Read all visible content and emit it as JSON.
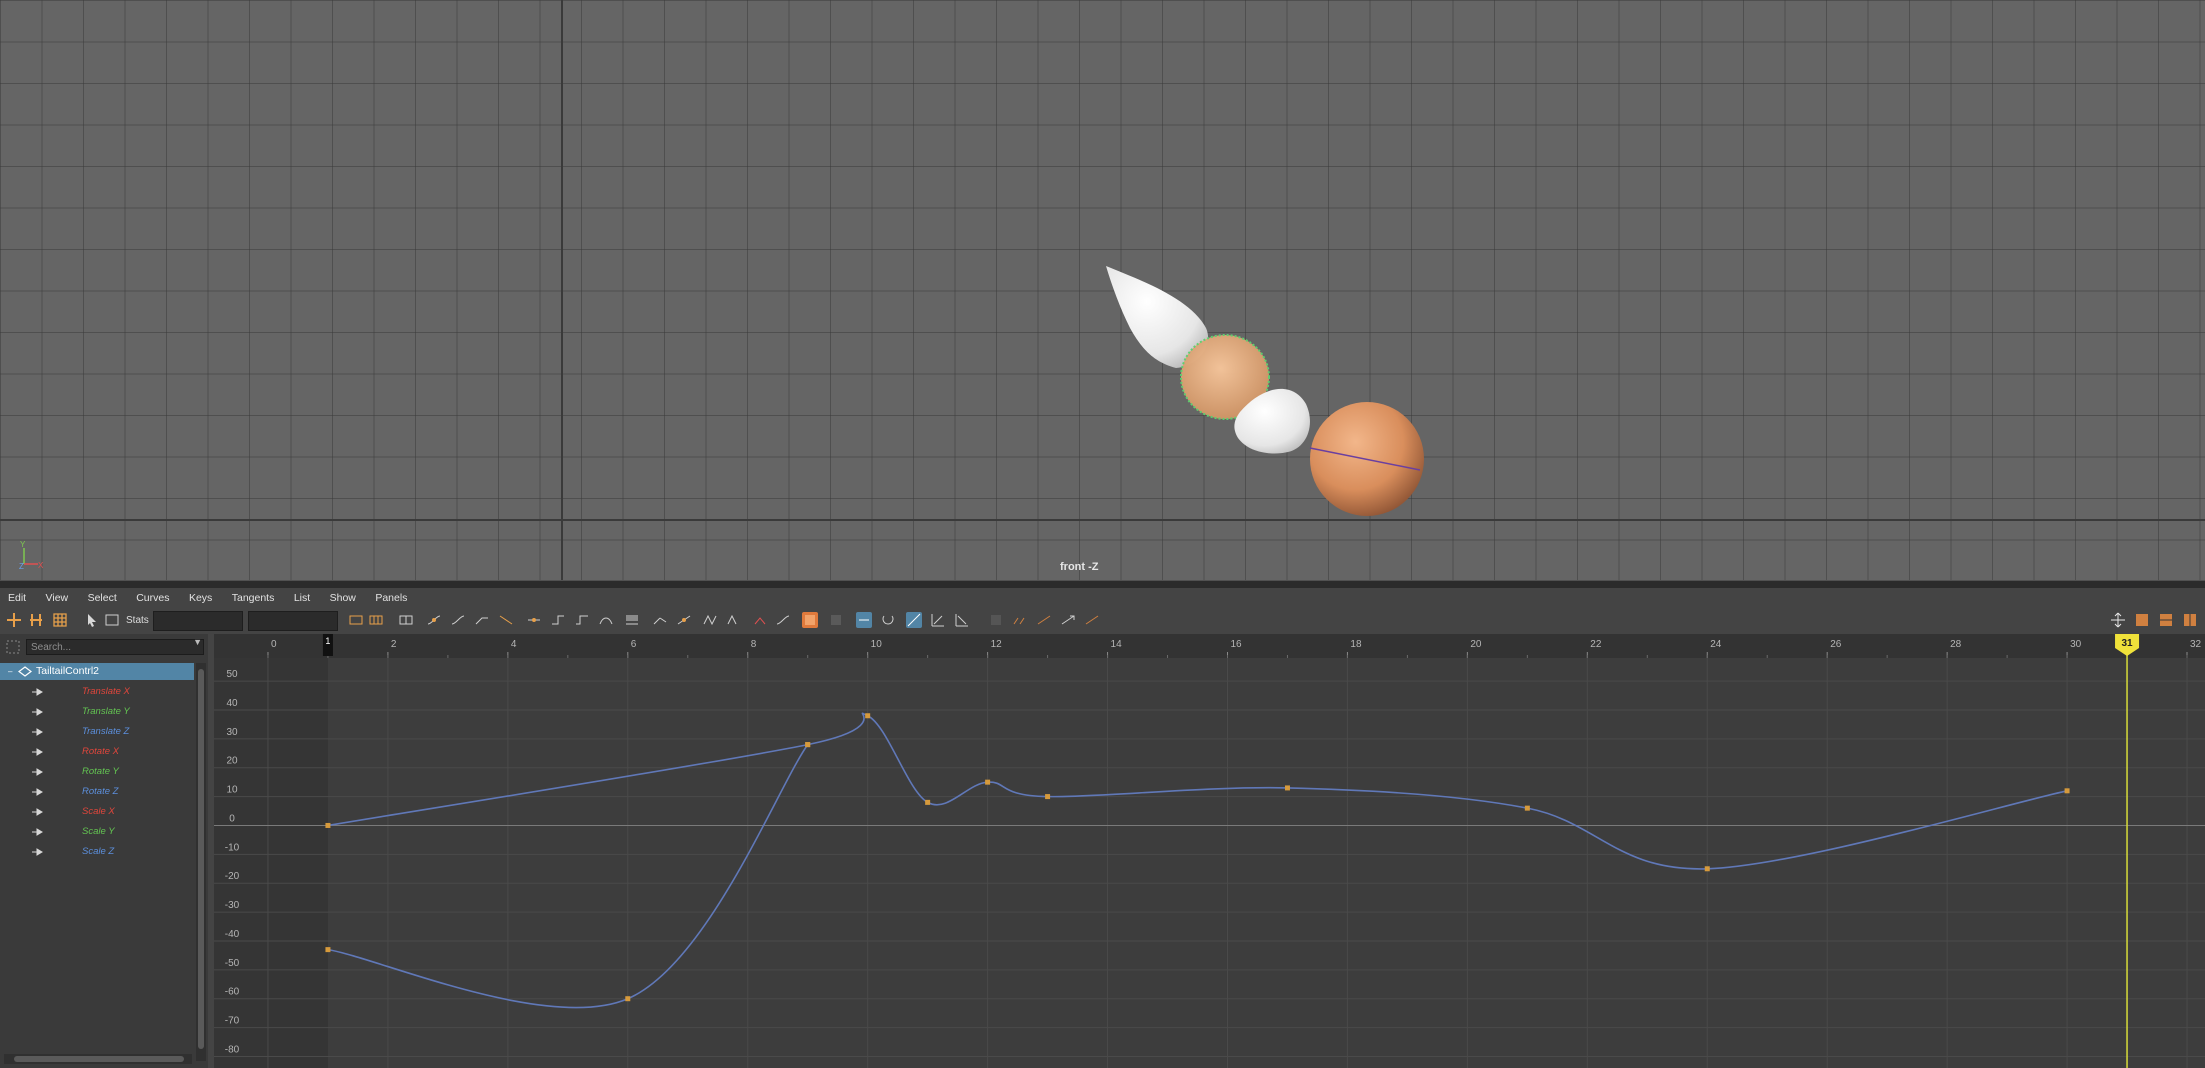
{
  "viewport": {
    "camera_label": "front -Z",
    "axis_gizmo": {
      "y_label": "Y",
      "x_label": "X",
      "z_label": "Z",
      "y_color": "#7ec850",
      "x_color": "#e05050",
      "z_color": "#6aa0e8"
    }
  },
  "graph_editor": {
    "menu": [
      "Edit",
      "View",
      "Select",
      "Curves",
      "Keys",
      "Tangents",
      "List",
      "Show",
      "Panels"
    ],
    "toolbar": {
      "stats_label": "Stats",
      "stats_value_1": "",
      "stats_value_2": ""
    },
    "outliner": {
      "search_placeholder": "Search...",
      "root_item": "TailtailContrl2",
      "channels": [
        {
          "label": "Translate X",
          "color": "#e0463c"
        },
        {
          "label": "Translate Y",
          "color": "#63c452"
        },
        {
          "label": "Translate Z",
          "color": "#5c8fdc"
        },
        {
          "label": "Rotate X",
          "color": "#e0463c"
        },
        {
          "label": "Rotate Y",
          "color": "#63c452"
        },
        {
          "label": "Rotate Z",
          "color": "#5c8fdc"
        },
        {
          "label": "Scale X",
          "color": "#e0463c"
        },
        {
          "label": "Scale Y",
          "color": "#63c452"
        },
        {
          "label": "Scale Z",
          "color": "#5c8fdc"
        }
      ]
    }
  },
  "chart_data": {
    "type": "line",
    "title": "",
    "xlabel": "",
    "ylabel": "",
    "x_ticks": [
      0,
      2,
      4,
      6,
      8,
      10,
      12,
      14,
      16,
      18,
      20,
      22,
      24,
      26,
      28,
      30,
      32
    ],
    "y_ticks": [
      50,
      40,
      30,
      20,
      10,
      0,
      -10,
      -20,
      -30,
      -40,
      -50,
      -60,
      -70,
      -80
    ],
    "xlim": [
      -0.9,
      32.3
    ],
    "ylim": [
      -84,
      58
    ],
    "current_frame": 31,
    "current_frame_label": "31",
    "range_start_frame": 1,
    "range_start_label": "1",
    "curve_color": "#6078b8",
    "key_color": "#d69a3c",
    "series": [
      {
        "name": "",
        "keys": [
          [
            1,
            0
          ],
          [
            9,
            28
          ],
          [
            10,
            38
          ],
          [
            11,
            8
          ],
          [
            12,
            15
          ],
          [
            13,
            10
          ],
          [
            17,
            13
          ],
          [
            21,
            6
          ],
          [
            24,
            -15
          ],
          [
            30,
            12
          ]
        ]
      },
      {
        "name": "",
        "keys": [
          [
            1,
            -43
          ],
          [
            6,
            -60
          ],
          [
            9,
            28
          ]
        ]
      }
    ]
  }
}
